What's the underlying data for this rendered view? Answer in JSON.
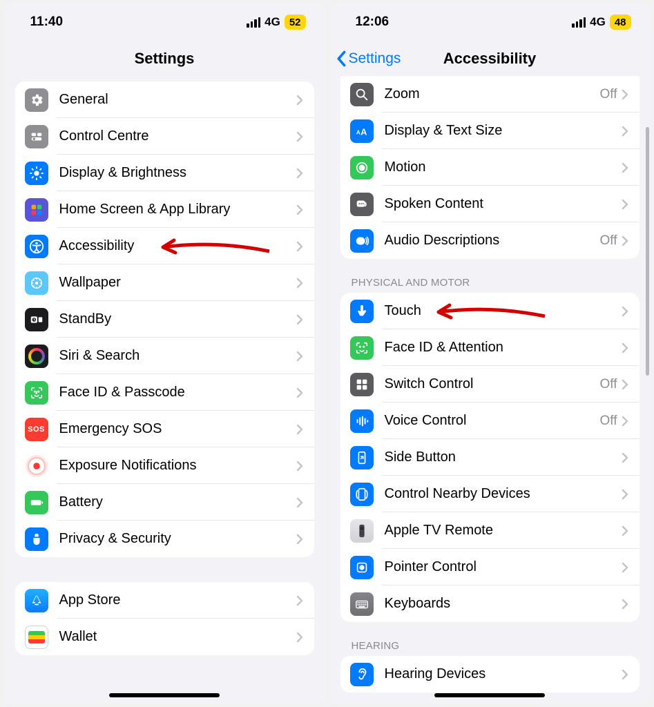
{
  "left": {
    "status": {
      "time": "11:40",
      "network": "4G",
      "battery": "52"
    },
    "navbar": {
      "title": "Settings"
    },
    "group1": [
      {
        "label": "General"
      },
      {
        "label": "Control Centre"
      },
      {
        "label": "Display & Brightness"
      },
      {
        "label": "Home Screen & App Library"
      },
      {
        "label": "Accessibility"
      },
      {
        "label": "Wallpaper"
      },
      {
        "label": "StandBy"
      },
      {
        "label": "Siri & Search"
      },
      {
        "label": "Face ID & Passcode"
      },
      {
        "label": "Emergency SOS"
      },
      {
        "label": "Exposure Notifications"
      },
      {
        "label": "Battery"
      },
      {
        "label": "Privacy & Security"
      }
    ],
    "group2": [
      {
        "label": "App Store"
      },
      {
        "label": "Wallet"
      }
    ]
  },
  "right": {
    "status": {
      "time": "12:06",
      "network": "4G",
      "battery": "48"
    },
    "navbar": {
      "back": "Settings",
      "title": "Accessibility"
    },
    "groupA": [
      {
        "label": "Zoom",
        "value": "Off"
      },
      {
        "label": "Display & Text Size"
      },
      {
        "label": "Motion"
      },
      {
        "label": "Spoken Content"
      },
      {
        "label": "Audio Descriptions",
        "value": "Off"
      }
    ],
    "headerB": "Physical and Motor",
    "groupB": [
      {
        "label": "Touch"
      },
      {
        "label": "Face ID & Attention"
      },
      {
        "label": "Switch Control",
        "value": "Off"
      },
      {
        "label": "Voice Control",
        "value": "Off"
      },
      {
        "label": "Side Button"
      },
      {
        "label": "Control Nearby Devices"
      },
      {
        "label": "Apple TV Remote"
      },
      {
        "label": "Pointer Control"
      },
      {
        "label": "Keyboards"
      }
    ],
    "headerC": "Hearing",
    "groupC": [
      {
        "label": "Hearing Devices"
      }
    ]
  }
}
